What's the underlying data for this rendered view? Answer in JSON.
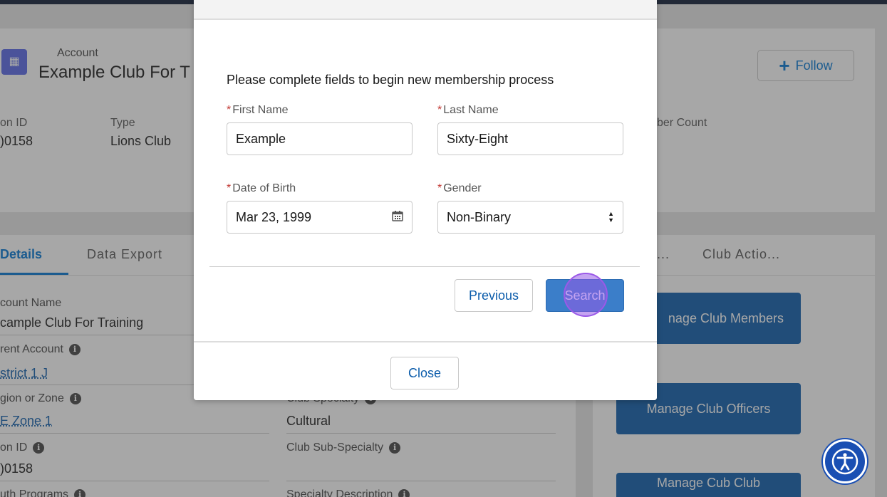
{
  "account": {
    "object_label": "Account",
    "name": "Example Club For T",
    "follow_label": "Follow"
  },
  "highlights": {
    "id_label": "on ID",
    "id_value": ")0158",
    "type_label": "Type",
    "type_value": "Lions Club",
    "count_label": "ber Count"
  },
  "tabs": {
    "details": "Details",
    "data_export": "Data Export",
    "ellipsis": "...",
    "club_actions": "Club Actio..."
  },
  "fields": {
    "account_name_label": "count Name",
    "account_name_value": "cample Club For Training",
    "parent_account_label": "rent Account",
    "parent_account_value": "strict 1 J",
    "region_label": "gion or Zone",
    "region_value": "E Zone 1",
    "id_label": "on ID",
    "id_value": ")0158",
    "youth_label": "uth Programs",
    "specialty_label": "Club Specialty",
    "specialty_value": "Cultural",
    "sub_specialty_label": "Club Sub-Specialty",
    "specialty_desc_label": "Specialty Description"
  },
  "side_actions": {
    "members": "nage Club Members",
    "officers": "Manage Club Officers",
    "cub_club": "Manage Cub Club"
  },
  "modal": {
    "title": "Please complete fields to begin new membership process",
    "required_marker": "*",
    "first_name_label": "First Name",
    "first_name_value": "Example",
    "last_name_label": "Last Name",
    "last_name_value": "Sixty-Eight",
    "dob_label": "Date of Birth",
    "dob_value": "Mar 23, 1999",
    "gender_label": "Gender",
    "gender_value": "Non-Binary",
    "previous_label": "Previous",
    "search_label": "Search",
    "close_label": "Close"
  },
  "icons": {
    "account": "building-icon",
    "follow": "plus-icon",
    "calendar": "calendar-icon",
    "select": "sort-arrows-icon",
    "info": "info-icon",
    "accessibility": "accessibility-icon"
  },
  "colors": {
    "brand_blue": "#0176d3",
    "action_button": "#0b5cab",
    "highlight_purple": "#9b59e8",
    "required": "#c23934"
  }
}
